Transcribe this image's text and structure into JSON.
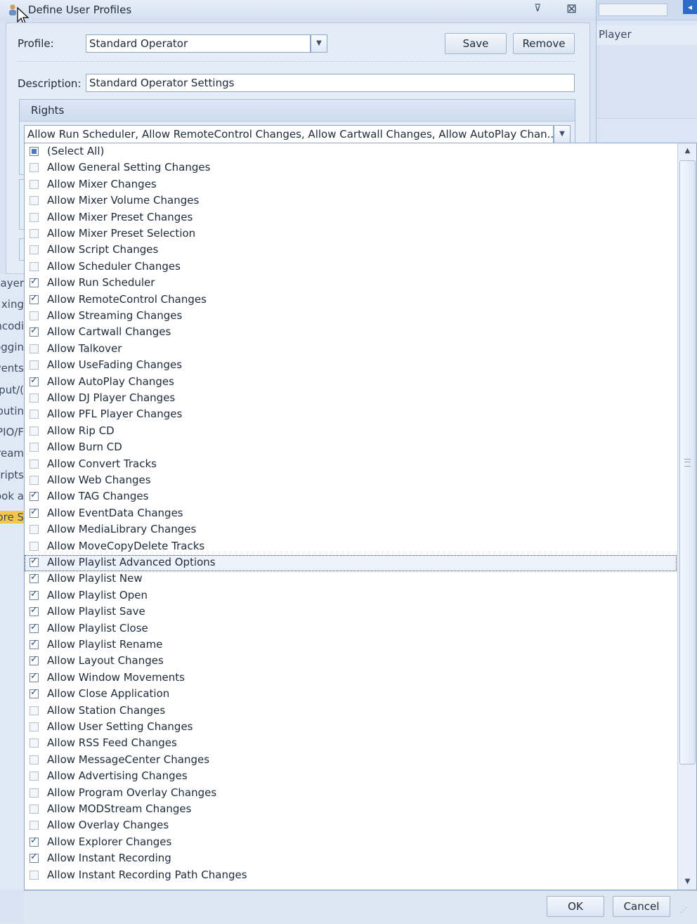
{
  "window": {
    "title": "Define User Profiles"
  },
  "profile": {
    "label": "Profile:",
    "value": "Standard Operator",
    "save_label": "Save",
    "remove_label": "Remove"
  },
  "description": {
    "label": "Description:",
    "value": "Standard Operator Settings"
  },
  "rights": {
    "header": "Rights",
    "summary": "Allow Run Scheduler, Allow RemoteControl Changes, Allow Cartwall Changes, Allow AutoPlay Chan...",
    "items": [
      {
        "label": "(Select All)",
        "state": "partial"
      },
      {
        "label": "Allow General Setting Changes",
        "state": "off"
      },
      {
        "label": "Allow Mixer Changes",
        "state": "off"
      },
      {
        "label": "Allow Mixer Volume Changes",
        "state": "off"
      },
      {
        "label": "Allow Mixer Preset Changes",
        "state": "off"
      },
      {
        "label": "Allow Mixer Preset Selection",
        "state": "off"
      },
      {
        "label": "Allow Script Changes",
        "state": "off"
      },
      {
        "label": "Allow Scheduler Changes",
        "state": "off"
      },
      {
        "label": "Allow Run Scheduler",
        "state": "on"
      },
      {
        "label": "Allow RemoteControl Changes",
        "state": "on"
      },
      {
        "label": "Allow Streaming Changes",
        "state": "off"
      },
      {
        "label": "Allow Cartwall Changes",
        "state": "on"
      },
      {
        "label": "Allow Talkover",
        "state": "off"
      },
      {
        "label": "Allow UseFading Changes",
        "state": "off"
      },
      {
        "label": "Allow AutoPlay Changes",
        "state": "on"
      },
      {
        "label": "Allow DJ Player Changes",
        "state": "off"
      },
      {
        "label": "Allow PFL Player Changes",
        "state": "off"
      },
      {
        "label": "Allow Rip CD",
        "state": "off"
      },
      {
        "label": "Allow Burn CD",
        "state": "off"
      },
      {
        "label": "Allow Convert Tracks",
        "state": "off"
      },
      {
        "label": "Allow Web Changes",
        "state": "off"
      },
      {
        "label": "Allow TAG Changes",
        "state": "on"
      },
      {
        "label": "Allow EventData Changes",
        "state": "on"
      },
      {
        "label": "Allow MediaLibrary Changes",
        "state": "off"
      },
      {
        "label": "Allow MoveCopyDelete Tracks",
        "state": "off"
      },
      {
        "label": "Allow Playlist Advanced Options",
        "state": "on",
        "focused": true
      },
      {
        "label": "Allow Playlist New",
        "state": "on"
      },
      {
        "label": "Allow Playlist Open",
        "state": "on"
      },
      {
        "label": "Allow Playlist Save",
        "state": "on"
      },
      {
        "label": "Allow Playlist Close",
        "state": "on"
      },
      {
        "label": "Allow Playlist Rename",
        "state": "on"
      },
      {
        "label": "Allow Layout Changes",
        "state": "on"
      },
      {
        "label": "Allow Window Movements",
        "state": "on"
      },
      {
        "label": "Allow Close Application",
        "state": "on"
      },
      {
        "label": "Allow Station Changes",
        "state": "off"
      },
      {
        "label": "Allow User Setting Changes",
        "state": "off"
      },
      {
        "label": "Allow RSS Feed Changes",
        "state": "off"
      },
      {
        "label": "Allow MessageCenter Changes",
        "state": "off"
      },
      {
        "label": "Allow Advertising Changes",
        "state": "off"
      },
      {
        "label": "Allow Program Overlay Changes",
        "state": "off"
      },
      {
        "label": "Allow MODStream Changes",
        "state": "off"
      },
      {
        "label": "Allow Overlay Changes",
        "state": "off"
      },
      {
        "label": "Allow Explorer Changes",
        "state": "on"
      },
      {
        "label": "Allow Instant Recording",
        "state": "on"
      },
      {
        "label": "Allow Instant Recording Path Changes",
        "state": "off"
      }
    ]
  },
  "footer": {
    "ok_label": "OK",
    "cancel_label": "Cancel"
  },
  "background_app": {
    "column_header": "Player",
    "left_items": [
      "ayer",
      "xing",
      "ncodi",
      "oggin",
      "vents",
      "put/(",
      "outin",
      "PIO/F",
      "ream",
      "cripts",
      "ook a",
      "ore S"
    ]
  },
  "colors": {
    "highlight": "#f6c64b",
    "accent_icon": "#2c6cc4"
  }
}
